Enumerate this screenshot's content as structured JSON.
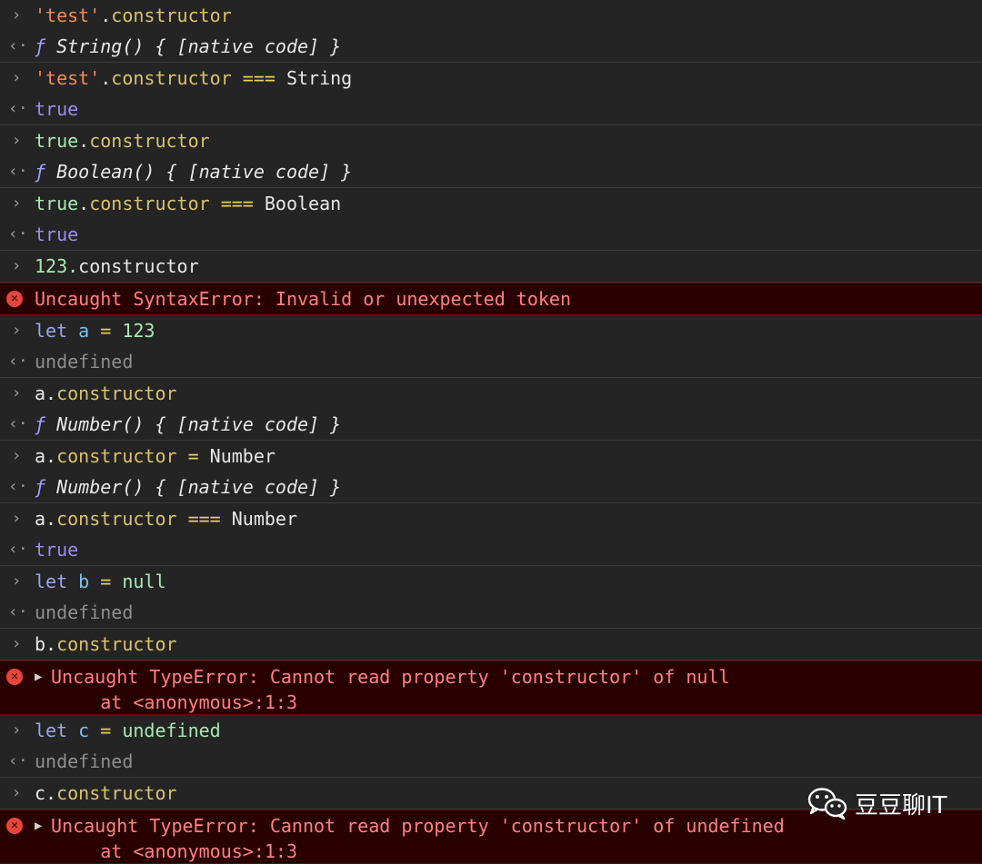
{
  "console": {
    "rows": [
      {
        "kind": "io",
        "lines": [
          {
            "prompt": "input",
            "tokens": [
              {
                "t": "'test'",
                "c": "s"
              },
              {
                "t": ".",
                "c": "tx"
              },
              {
                "t": "constructor",
                "c": "p"
              }
            ]
          },
          {
            "prompt": "output",
            "tokens": [
              {
                "t": "ƒ",
                "c": "fn"
              },
              {
                "t": " String() { [native code] }",
                "c": "it"
              }
            ]
          }
        ]
      },
      {
        "kind": "io",
        "lines": [
          {
            "prompt": "input",
            "tokens": [
              {
                "t": "'test'",
                "c": "s"
              },
              {
                "t": ".",
                "c": "tx"
              },
              {
                "t": "constructor",
                "c": "p"
              },
              {
                "t": " === ",
                "c": "op"
              },
              {
                "t": "String",
                "c": "tx"
              }
            ]
          },
          {
            "prompt": "output",
            "tokens": [
              {
                "t": "true",
                "c": "b"
              }
            ]
          }
        ]
      },
      {
        "kind": "io",
        "lines": [
          {
            "prompt": "input",
            "tokens": [
              {
                "t": "true",
                "c": "n"
              },
              {
                "t": ".",
                "c": "tx"
              },
              {
                "t": "constructor",
                "c": "p"
              }
            ]
          },
          {
            "prompt": "output",
            "tokens": [
              {
                "t": "ƒ",
                "c": "fn"
              },
              {
                "t": " Boolean() { [native code] }",
                "c": "it"
              }
            ]
          }
        ]
      },
      {
        "kind": "io",
        "lines": [
          {
            "prompt": "input",
            "tokens": [
              {
                "t": "true",
                "c": "n"
              },
              {
                "t": ".",
                "c": "tx"
              },
              {
                "t": "constructor",
                "c": "p"
              },
              {
                "t": " === ",
                "c": "op"
              },
              {
                "t": "Boolean",
                "c": "tx"
              }
            ]
          },
          {
            "prompt": "output",
            "tokens": [
              {
                "t": "true",
                "c": "b"
              }
            ]
          }
        ]
      },
      {
        "kind": "io",
        "lines": [
          {
            "prompt": "input",
            "tokens": [
              {
                "t": "123.",
                "c": "n"
              },
              {
                "t": "constructor",
                "c": "tx"
              }
            ]
          }
        ]
      },
      {
        "kind": "error",
        "expand": false,
        "lines": [
          "Uncaught SyntaxError: Invalid or unexpected token"
        ]
      },
      {
        "kind": "io",
        "lines": [
          {
            "prompt": "input",
            "tokens": [
              {
                "t": "let",
                "c": "kw"
              },
              {
                "t": " ",
                "c": "tx"
              },
              {
                "t": "a",
                "c": "v"
              },
              {
                "t": " = ",
                "c": "op"
              },
              {
                "t": "123",
                "c": "n"
              }
            ]
          },
          {
            "prompt": "output",
            "tokens": [
              {
                "t": "undefined",
                "c": "u"
              }
            ]
          }
        ]
      },
      {
        "kind": "io",
        "lines": [
          {
            "prompt": "input",
            "tokens": [
              {
                "t": "a.",
                "c": "tx"
              },
              {
                "t": "constructor",
                "c": "p"
              }
            ]
          },
          {
            "prompt": "output",
            "tokens": [
              {
                "t": "ƒ",
                "c": "fn"
              },
              {
                "t": " Number() { [native code] }",
                "c": "it"
              }
            ]
          }
        ]
      },
      {
        "kind": "io",
        "lines": [
          {
            "prompt": "input",
            "tokens": [
              {
                "t": "a.",
                "c": "tx"
              },
              {
                "t": "constructor",
                "c": "p"
              },
              {
                "t": " = ",
                "c": "op"
              },
              {
                "t": "Number",
                "c": "tx"
              }
            ]
          },
          {
            "prompt": "output",
            "tokens": [
              {
                "t": "ƒ",
                "c": "fn"
              },
              {
                "t": " Number() { [native code] }",
                "c": "it"
              }
            ]
          }
        ]
      },
      {
        "kind": "io",
        "lines": [
          {
            "prompt": "input",
            "tokens": [
              {
                "t": "a.",
                "c": "tx"
              },
              {
                "t": "constructor",
                "c": "p"
              },
              {
                "t": " === ",
                "c": "op"
              },
              {
                "t": "Number",
                "c": "tx"
              }
            ]
          },
          {
            "prompt": "output",
            "tokens": [
              {
                "t": "true",
                "c": "b"
              }
            ]
          }
        ]
      },
      {
        "kind": "io",
        "lines": [
          {
            "prompt": "input",
            "tokens": [
              {
                "t": "let",
                "c": "kw"
              },
              {
                "t": " ",
                "c": "tx"
              },
              {
                "t": "b",
                "c": "v"
              },
              {
                "t": " = ",
                "c": "op"
              },
              {
                "t": "null",
                "c": "n"
              }
            ]
          },
          {
            "prompt": "output",
            "tokens": [
              {
                "t": "undefined",
                "c": "u"
              }
            ]
          }
        ]
      },
      {
        "kind": "io",
        "lines": [
          {
            "prompt": "input",
            "tokens": [
              {
                "t": "b.",
                "c": "tx"
              },
              {
                "t": "constructor",
                "c": "p"
              }
            ]
          }
        ]
      },
      {
        "kind": "error",
        "expand": true,
        "lines": [
          "Uncaught TypeError: Cannot read property 'constructor' of null",
          "    at <anonymous>:1:3"
        ]
      },
      {
        "kind": "io",
        "lines": [
          {
            "prompt": "input",
            "tokens": [
              {
                "t": "let",
                "c": "kw"
              },
              {
                "t": " ",
                "c": "tx"
              },
              {
                "t": "c",
                "c": "v"
              },
              {
                "t": " = ",
                "c": "op"
              },
              {
                "t": "undefined",
                "c": "n"
              }
            ]
          },
          {
            "prompt": "output",
            "tokens": [
              {
                "t": "undefined",
                "c": "u"
              }
            ]
          }
        ]
      },
      {
        "kind": "io",
        "lines": [
          {
            "prompt": "input",
            "tokens": [
              {
                "t": "c.",
                "c": "tx"
              },
              {
                "t": "constructor",
                "c": "p"
              }
            ]
          }
        ]
      },
      {
        "kind": "error",
        "expand": true,
        "lines": [
          "Uncaught TypeError: Cannot read property 'constructor' of undefined",
          "    at <anonymous>:1:3"
        ]
      }
    ]
  },
  "icons": {
    "input_prompt": "›",
    "output_prompt": "‹·",
    "error_icon": "✕",
    "expand": "▶"
  },
  "colors": {
    "background": "#242424",
    "error_background": "#290000",
    "error_text": "#ff8080",
    "string": "#f28b54",
    "property": "#d9c26c",
    "keyword": "#9aa6e8",
    "boolean": "#9a8cf2"
  },
  "watermark": {
    "text": "豆豆聊IT"
  }
}
